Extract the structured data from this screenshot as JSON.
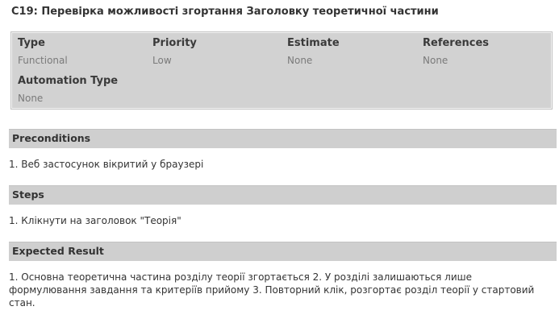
{
  "title": "C19: Перевірка можливості згортання Заголовку теоретичної частини",
  "properties": [
    {
      "label": "Type",
      "value": "Functional"
    },
    {
      "label": "Priority",
      "value": "Low"
    },
    {
      "label": "Estimate",
      "value": "None"
    },
    {
      "label": "References",
      "value": "None"
    },
    {
      "label": "Automation Type",
      "value": "None"
    }
  ],
  "sections": {
    "preconditions": {
      "heading": "Preconditions",
      "text": "1. Веб застосунок вікритий у браузері"
    },
    "steps": {
      "heading": "Steps",
      "text": "1. Клікнути на заголовок \"Теорія\""
    },
    "expected_result": {
      "heading": "Expected Result",
      "text": "1. Основна теоретична частина розділу теорії згортається 2. У розділі залишаються лише формулювання завдання та критеріїв прийому 3. Повторний клік, розгортає розділ теорії у стартовий стан."
    }
  }
}
